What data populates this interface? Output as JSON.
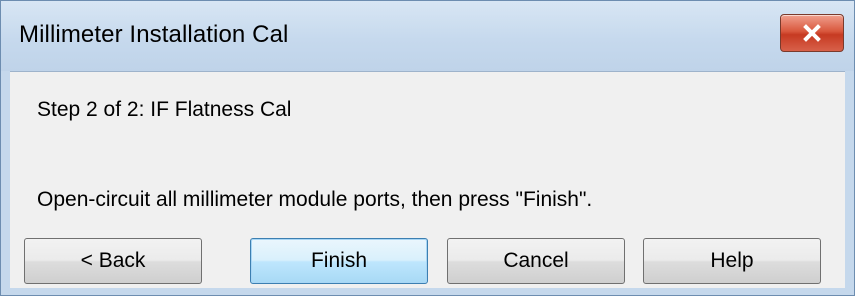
{
  "window": {
    "title": "Millimeter Installation Cal",
    "close_icon": "close-icon"
  },
  "content": {
    "step": "Step 2 of 2: IF Flatness Cal",
    "instruction": "Open-circuit all millimeter module ports, then press \"Finish\"."
  },
  "buttons": {
    "back": "< Back",
    "finish": "Finish",
    "cancel": "Cancel",
    "help": "Help"
  },
  "colors": {
    "titlebar": "#c6d9ed",
    "close_button": "#d9583e",
    "client_background": "#f0f0f0",
    "default_button_border": "#3c7fb1"
  }
}
